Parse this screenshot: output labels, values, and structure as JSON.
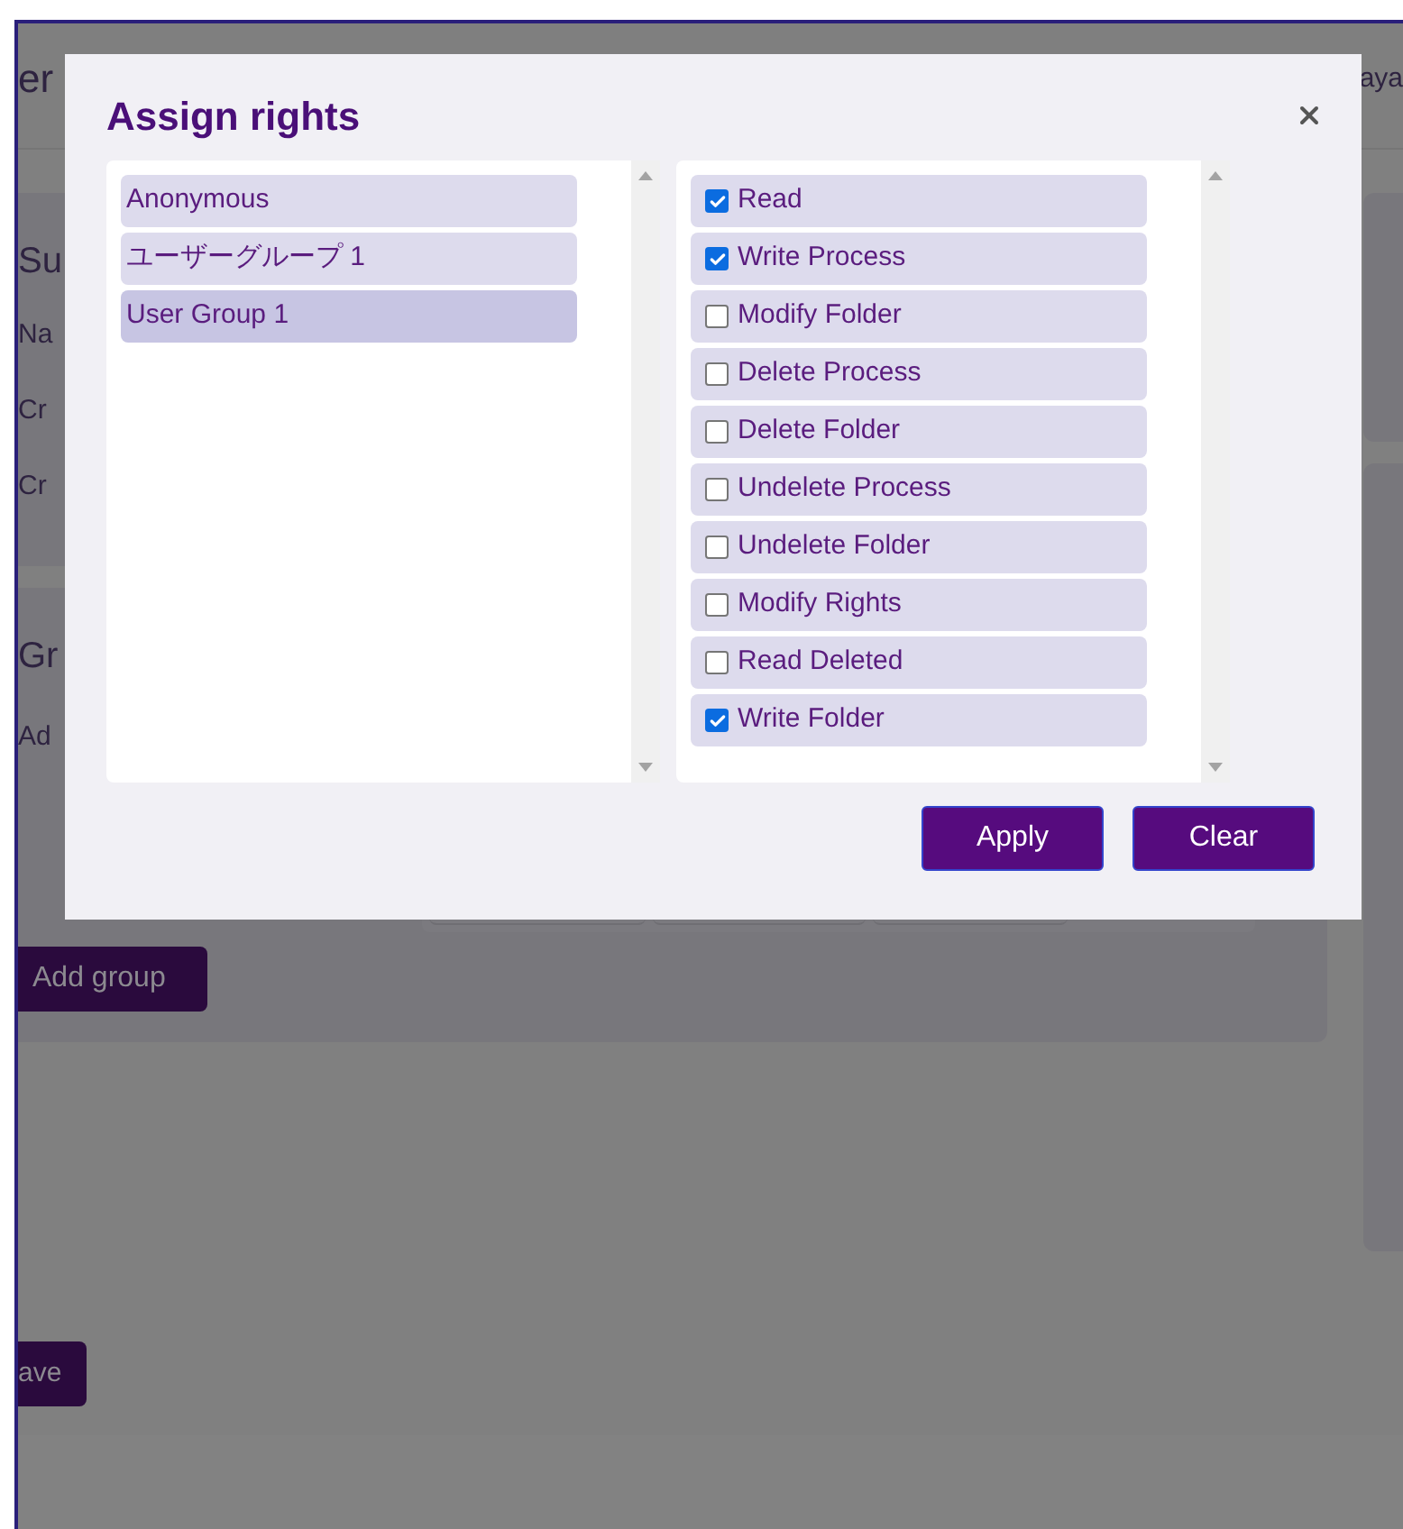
{
  "page": {
    "header_title": "er",
    "header_user": "aya",
    "summary": {
      "title": "Su",
      "fields": [
        "Na",
        "Cr",
        "Cr"
      ]
    },
    "groups": {
      "title": "Gr",
      "row": "Ad",
      "add_button": "Add group"
    },
    "save_button": "ave"
  },
  "dialog": {
    "title": "Assign rights",
    "groups": [
      {
        "label": "Anonymous",
        "selected": false
      },
      {
        "label": "ユーザーグループ 1",
        "selected": false
      },
      {
        "label": "User Group 1",
        "selected": true
      }
    ],
    "rights": [
      {
        "label": "Read",
        "checked": true
      },
      {
        "label": "Write Process",
        "checked": true
      },
      {
        "label": "Modify Folder",
        "checked": false
      },
      {
        "label": "Delete Process",
        "checked": false
      },
      {
        "label": "Delete Folder",
        "checked": false
      },
      {
        "label": "Undelete Process",
        "checked": false
      },
      {
        "label": "Undelete Folder",
        "checked": false
      },
      {
        "label": "Modify Rights",
        "checked": false
      },
      {
        "label": "Read Deleted",
        "checked": false
      },
      {
        "label": "Write Folder",
        "checked": true
      }
    ],
    "buttons": [
      "Apply",
      "Clear"
    ]
  }
}
